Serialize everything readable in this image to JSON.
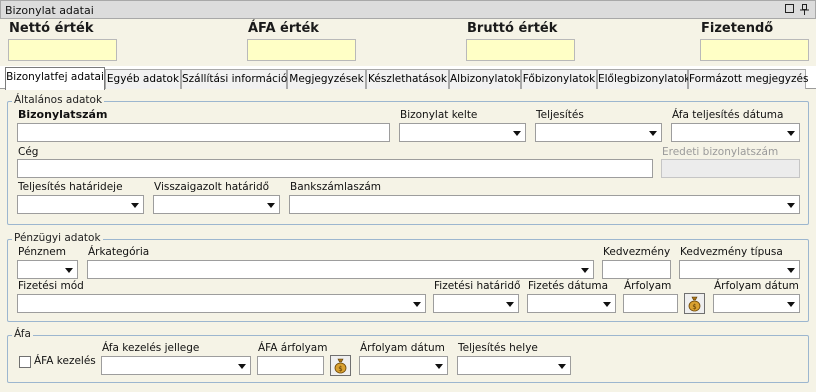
{
  "window": {
    "title": "Bizonylat adatai"
  },
  "summary": {
    "netto_label": "Nettó érték",
    "afa_label": "ÁFA érték",
    "brutto_label": "Bruttó érték",
    "fizetendo_label": "Fizetendő"
  },
  "tabs": [
    "Bizonylatfej adatai",
    "Egyéb adatok",
    "Szállítási információk",
    "Megjegyzések",
    "Készlethatások",
    "Albizonylatok",
    "Főbizonylatok",
    "Előlegbizonylatok",
    "Formázott megjegyzés"
  ],
  "general": {
    "title": "Általános adatok",
    "bizonylatszam": "Bizonylatszám",
    "kelte": "Bizonylat kelte",
    "teljesites": "Teljesítés",
    "afa_telj_datum": "Áfa teljesítés dátuma",
    "ceg": "Cég",
    "eredeti": "Eredeti bizonylatszám",
    "telj_hatarido": "Teljesítés határideje",
    "visszaigazolt": "Visszaigazolt határidő",
    "bankszamla": "Bankszámlaszám"
  },
  "financial": {
    "title": "Pénzügyi adatok",
    "penznem": "Pénznem",
    "arkategoria": "Árkategória",
    "kedvezmeny": "Kedvezmény",
    "kedv_tipus": "Kedvezmény típusa",
    "fizetesi_mod": "Fizetési mód",
    "fiz_hatarido": "Fizetési határidő",
    "fiz_datum": "Fizetés dátuma",
    "arfolyam": "Árfolyam",
    "arfolyam_datum": "Árfolyam dátum"
  },
  "vat": {
    "title": "Áfa",
    "afa_kezeles": "ÁFA kezelés",
    "kezeles_jellege": "Áfa kezelés jellege",
    "afa_arfolyam": "ÁFA árfolyam",
    "arfolyam_datum": "Árfolyam dátum",
    "telj_helye": "Teljesítés helye"
  }
}
